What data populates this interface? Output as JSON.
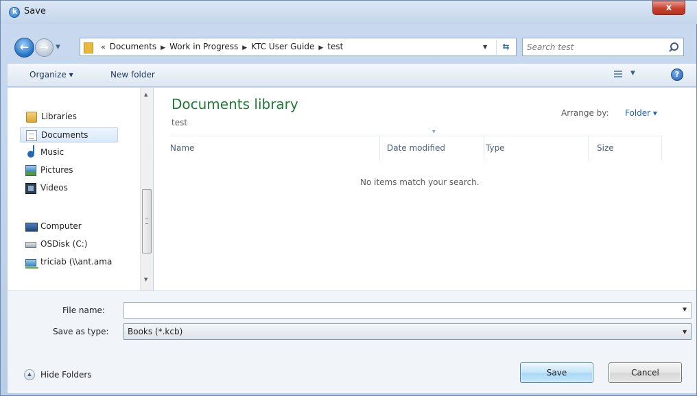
{
  "window": {
    "title": "Save",
    "close_label": "x"
  },
  "address": {
    "overflow": "«",
    "breadcrumbs": [
      "Documents",
      "Work in Progress",
      "KTC User Guide",
      "test"
    ]
  },
  "search": {
    "placeholder": "Search test"
  },
  "toolbar": {
    "organize_label": "Organize ▾",
    "new_folder_label": "New folder",
    "help_label": "?"
  },
  "nav": {
    "items": [
      {
        "label": "Libraries",
        "icon": "libraries-icon"
      },
      {
        "label": "Documents",
        "icon": "documents-icon",
        "selected": true
      },
      {
        "label": "Music",
        "icon": "music-icon"
      },
      {
        "label": "Pictures",
        "icon": "pictures-icon"
      },
      {
        "label": "Videos",
        "icon": "videos-icon"
      },
      {
        "label": "Computer",
        "icon": "computer-icon"
      },
      {
        "label": "OSDisk (C:)",
        "icon": "disk-icon"
      },
      {
        "label": "triciab (\\\\ant.ama",
        "icon": "network-drive-icon"
      }
    ]
  },
  "library": {
    "title": "Documents library",
    "subtitle": "test",
    "arrange_label": "Arrange by:",
    "arrange_value": "Folder ▾"
  },
  "columns": [
    "Name",
    "Date modified",
    "Type",
    "Size"
  ],
  "empty_message": "No items match your search.",
  "form": {
    "filename_label": "File name:",
    "filename_value": "",
    "savetype_label": "Save as type:",
    "savetype_value": "Books (*.kcb)"
  },
  "footer": {
    "hide_folders_label": "Hide Folders",
    "save_label": "Save",
    "cancel_label": "Cancel"
  },
  "colors": {
    "accent": "#1f62b5",
    "library_title": "#1e7b34",
    "close_button": "#c7412d"
  }
}
